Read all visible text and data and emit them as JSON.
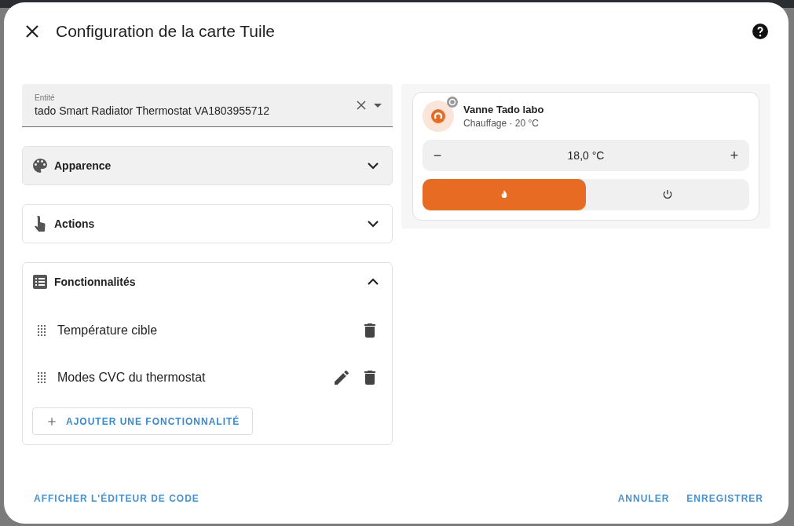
{
  "dialog": {
    "title": "Configuration de la carte Tuile"
  },
  "entity_field": {
    "label": "Entité",
    "value": "tado Smart Radiator Thermostat VA1803955712"
  },
  "sections": [
    {
      "kind": "palette",
      "title": "Apparence",
      "expanded": false,
      "highlighted": true
    },
    {
      "kind": "touch",
      "title": "Actions",
      "expanded": false,
      "highlighted": false
    },
    {
      "kind": "list",
      "title": "Fonctionnalités",
      "expanded": true,
      "highlighted": false,
      "features": [
        {
          "label": "Température cible",
          "editable": false
        },
        {
          "label": "Modes CVC du thermostat",
          "editable": true
        }
      ],
      "add_button": "AJOUTER UNE FONCTIONNALITÉ"
    }
  ],
  "preview": {
    "name": "Vanne Tado labo",
    "state": "Chauffage · 20 °C",
    "target": "18,0 °C",
    "minus": "−",
    "plus": "+",
    "modes": [
      {
        "kind": "heat",
        "selected": true
      },
      {
        "kind": "off",
        "selected": false
      }
    ]
  },
  "footer": {
    "code_editor": "AFFICHER L'ÉDITEUR DE CODE",
    "cancel": "ANNULER",
    "save": "ENREGISTRER"
  }
}
